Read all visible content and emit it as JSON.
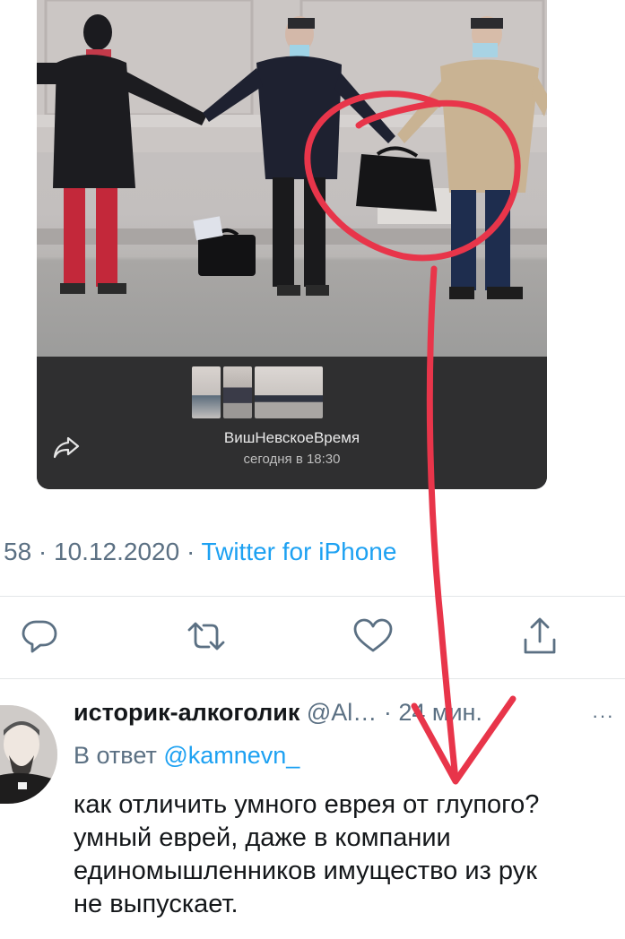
{
  "media_card": {
    "source_name": "ВишНевскоеВремя",
    "time_text": "сегодня в 18:30",
    "share_icon": "share-arrow-icon",
    "thumbnails": 3
  },
  "tweet": {
    "time_partial": "58 · 10.12.2020 · ",
    "client": "Twitter for iPhone"
  },
  "actions": [
    {
      "name": "reply",
      "icon": "comment-icon"
    },
    {
      "name": "retweet",
      "icon": "retweet-icon"
    },
    {
      "name": "like",
      "icon": "heart-icon"
    },
    {
      "name": "share",
      "icon": "share-icon"
    }
  ],
  "reply": {
    "display_name": "историк-алкоголик",
    "handle": "@Al…",
    "separator": "·",
    "time": "24 мин.",
    "more": "···",
    "reply_to_label": "В ответ",
    "reply_to_mention": "@kamnevn_",
    "body_lines": [
      "как отличить умного еврея от глупого?",
      "умный еврей, даже в компании",
      "единомышленников имущество из рук",
      "не выпускает."
    ]
  },
  "colors": {
    "link": "#1da1f2",
    "secondary_text": "#5b7083",
    "primary_text": "#14171a",
    "annotation_red": "#e8354a",
    "card_bar": "#2f2f30"
  }
}
